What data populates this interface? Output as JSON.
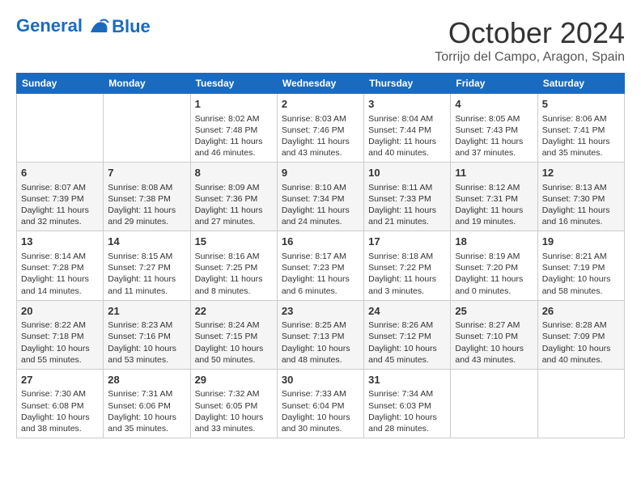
{
  "header": {
    "logo_line1": "General",
    "logo_line2": "Blue",
    "month": "October 2024",
    "location": "Torrijo del Campo, Aragon, Spain"
  },
  "days_of_week": [
    "Sunday",
    "Monday",
    "Tuesday",
    "Wednesday",
    "Thursday",
    "Friday",
    "Saturday"
  ],
  "weeks": [
    [
      {
        "day": "",
        "info": ""
      },
      {
        "day": "",
        "info": ""
      },
      {
        "day": "1",
        "info": "Sunrise: 8:02 AM\nSunset: 7:48 PM\nDaylight: 11 hours\nand 46 minutes."
      },
      {
        "day": "2",
        "info": "Sunrise: 8:03 AM\nSunset: 7:46 PM\nDaylight: 11 hours\nand 43 minutes."
      },
      {
        "day": "3",
        "info": "Sunrise: 8:04 AM\nSunset: 7:44 PM\nDaylight: 11 hours\nand 40 minutes."
      },
      {
        "day": "4",
        "info": "Sunrise: 8:05 AM\nSunset: 7:43 PM\nDaylight: 11 hours\nand 37 minutes."
      },
      {
        "day": "5",
        "info": "Sunrise: 8:06 AM\nSunset: 7:41 PM\nDaylight: 11 hours\nand 35 minutes."
      }
    ],
    [
      {
        "day": "6",
        "info": "Sunrise: 8:07 AM\nSunset: 7:39 PM\nDaylight: 11 hours\nand 32 minutes."
      },
      {
        "day": "7",
        "info": "Sunrise: 8:08 AM\nSunset: 7:38 PM\nDaylight: 11 hours\nand 29 minutes."
      },
      {
        "day": "8",
        "info": "Sunrise: 8:09 AM\nSunset: 7:36 PM\nDaylight: 11 hours\nand 27 minutes."
      },
      {
        "day": "9",
        "info": "Sunrise: 8:10 AM\nSunset: 7:34 PM\nDaylight: 11 hours\nand 24 minutes."
      },
      {
        "day": "10",
        "info": "Sunrise: 8:11 AM\nSunset: 7:33 PM\nDaylight: 11 hours\nand 21 minutes."
      },
      {
        "day": "11",
        "info": "Sunrise: 8:12 AM\nSunset: 7:31 PM\nDaylight: 11 hours\nand 19 minutes."
      },
      {
        "day": "12",
        "info": "Sunrise: 8:13 AM\nSunset: 7:30 PM\nDaylight: 11 hours\nand 16 minutes."
      }
    ],
    [
      {
        "day": "13",
        "info": "Sunrise: 8:14 AM\nSunset: 7:28 PM\nDaylight: 11 hours\nand 14 minutes."
      },
      {
        "day": "14",
        "info": "Sunrise: 8:15 AM\nSunset: 7:27 PM\nDaylight: 11 hours\nand 11 minutes."
      },
      {
        "day": "15",
        "info": "Sunrise: 8:16 AM\nSunset: 7:25 PM\nDaylight: 11 hours\nand 8 minutes."
      },
      {
        "day": "16",
        "info": "Sunrise: 8:17 AM\nSunset: 7:23 PM\nDaylight: 11 hours\nand 6 minutes."
      },
      {
        "day": "17",
        "info": "Sunrise: 8:18 AM\nSunset: 7:22 PM\nDaylight: 11 hours\nand 3 minutes."
      },
      {
        "day": "18",
        "info": "Sunrise: 8:19 AM\nSunset: 7:20 PM\nDaylight: 11 hours\nand 0 minutes."
      },
      {
        "day": "19",
        "info": "Sunrise: 8:21 AM\nSunset: 7:19 PM\nDaylight: 10 hours\nand 58 minutes."
      }
    ],
    [
      {
        "day": "20",
        "info": "Sunrise: 8:22 AM\nSunset: 7:18 PM\nDaylight: 10 hours\nand 55 minutes."
      },
      {
        "day": "21",
        "info": "Sunrise: 8:23 AM\nSunset: 7:16 PM\nDaylight: 10 hours\nand 53 minutes."
      },
      {
        "day": "22",
        "info": "Sunrise: 8:24 AM\nSunset: 7:15 PM\nDaylight: 10 hours\nand 50 minutes."
      },
      {
        "day": "23",
        "info": "Sunrise: 8:25 AM\nSunset: 7:13 PM\nDaylight: 10 hours\nand 48 minutes."
      },
      {
        "day": "24",
        "info": "Sunrise: 8:26 AM\nSunset: 7:12 PM\nDaylight: 10 hours\nand 45 minutes."
      },
      {
        "day": "25",
        "info": "Sunrise: 8:27 AM\nSunset: 7:10 PM\nDaylight: 10 hours\nand 43 minutes."
      },
      {
        "day": "26",
        "info": "Sunrise: 8:28 AM\nSunset: 7:09 PM\nDaylight: 10 hours\nand 40 minutes."
      }
    ],
    [
      {
        "day": "27",
        "info": "Sunrise: 7:30 AM\nSunset: 6:08 PM\nDaylight: 10 hours\nand 38 minutes."
      },
      {
        "day": "28",
        "info": "Sunrise: 7:31 AM\nSunset: 6:06 PM\nDaylight: 10 hours\nand 35 minutes."
      },
      {
        "day": "29",
        "info": "Sunrise: 7:32 AM\nSunset: 6:05 PM\nDaylight: 10 hours\nand 33 minutes."
      },
      {
        "day": "30",
        "info": "Sunrise: 7:33 AM\nSunset: 6:04 PM\nDaylight: 10 hours\nand 30 minutes."
      },
      {
        "day": "31",
        "info": "Sunrise: 7:34 AM\nSunset: 6:03 PM\nDaylight: 10 hours\nand 28 minutes."
      },
      {
        "day": "",
        "info": ""
      },
      {
        "day": "",
        "info": ""
      }
    ]
  ]
}
